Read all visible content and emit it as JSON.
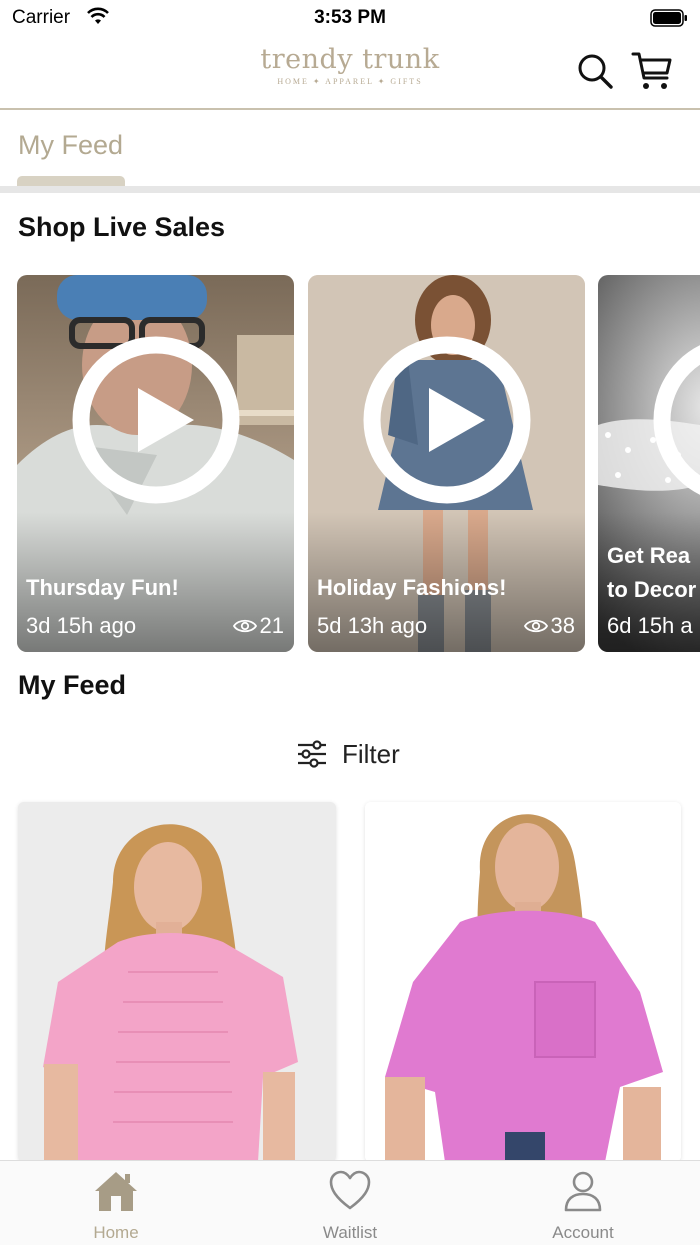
{
  "status_bar": {
    "carrier": "Carrier",
    "time": "3:53 PM"
  },
  "header": {
    "logo_title": "trendy trunk",
    "logo_subtitle": "HOME ✦ APPAREL ✦ GIFTS",
    "icons": [
      "search-icon",
      "cart-icon"
    ]
  },
  "tabs": [
    {
      "label": "My Feed",
      "selected": true
    }
  ],
  "live_sales": {
    "title": "Shop Live Sales",
    "cards": [
      {
        "title": "Thursday Fun!",
        "time": "3d 15h ago",
        "views": "21"
      },
      {
        "title": "Holiday Fashions!",
        "time": "5d 13h ago",
        "views": "38"
      },
      {
        "title": "Get Ready to Decorate",
        "title_line1": "Get Rea",
        "title_line2": "to Decor",
        "time": "6d 15h a"
      }
    ]
  },
  "feed": {
    "title": "My Feed",
    "filter_label": "Filter"
  },
  "products": [
    {
      "image": "pink-ribbed-top-photo"
    },
    {
      "image": "magenta-pocket-tee-photo"
    }
  ],
  "bottom_nav": [
    {
      "label": "Home",
      "icon": "home-icon",
      "active": true
    },
    {
      "label": "Waitlist",
      "icon": "heart-icon"
    },
    {
      "label": "Account",
      "icon": "person-icon"
    }
  ],
  "colors": {
    "accent": "#b3a991",
    "header_border": "#c9c1ae",
    "tab_indicator": "#d8d2c3",
    "nav_inactive": "#8a8a8a"
  }
}
